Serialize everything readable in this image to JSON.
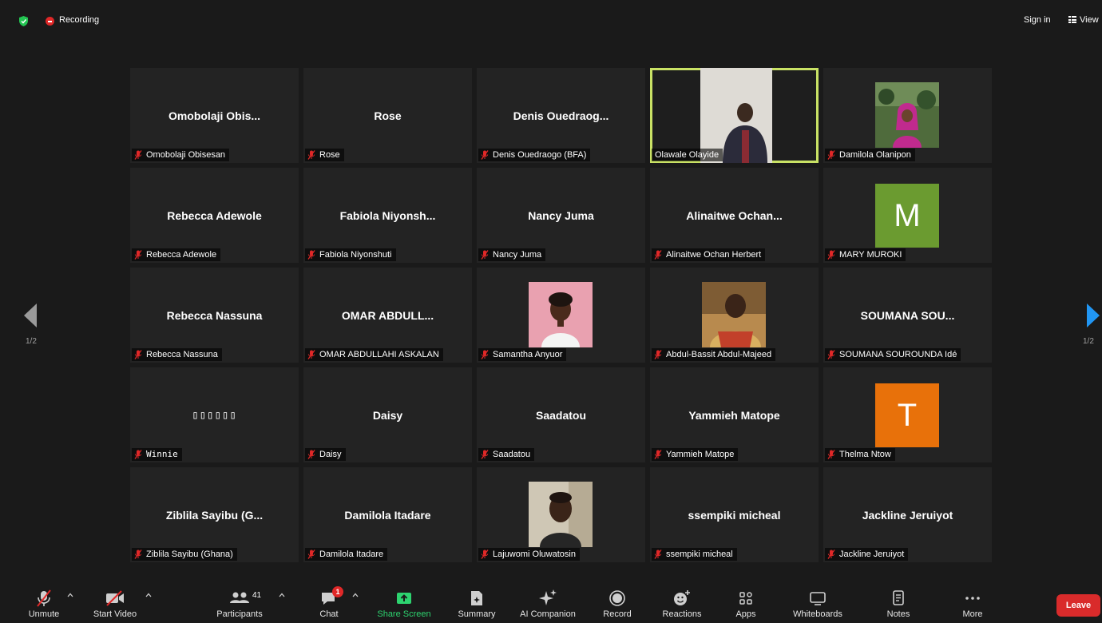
{
  "header": {
    "recording_label": "Recording",
    "sign_in_label": "Sign in",
    "view_label": "View"
  },
  "pager": {
    "left_page": "1/2",
    "right_page": "1/2"
  },
  "tiles": [
    {
      "display_name": "Omobolaji  Obis...",
      "label": "Omobolaji Obisesan",
      "muted": true
    },
    {
      "display_name": "Rose",
      "label": "Rose",
      "muted": true
    },
    {
      "display_name": "Denis  Ouedraog...",
      "label": "Denis Ouedraogo (BFA)",
      "muted": true
    },
    {
      "display_name": "",
      "label": "Olawale Olayide",
      "muted": false,
      "video": "photo",
      "active": true
    },
    {
      "display_name": "",
      "label": "Damilola Olanipon",
      "muted": true,
      "video": "photo"
    },
    {
      "display_name": "Rebecca Adewole",
      "label": "Rebecca Adewole",
      "muted": true
    },
    {
      "display_name": "Fabiola  Niyonsh...",
      "label": "Fabiola Niyonshuti",
      "muted": true
    },
    {
      "display_name": "Nancy Juma",
      "label": "Nancy Juma",
      "muted": true
    },
    {
      "display_name": "Alinaitwe  Ochan...",
      "label": "Alinaitwe Ochan Herbert",
      "muted": true
    },
    {
      "display_name": "",
      "label": "MARY MUROKI",
      "muted": true,
      "avatar_letter": "M",
      "avatar_color": "#6b9b30"
    },
    {
      "display_name": "Rebecca Nassuna",
      "label": "Rebecca Nassuna",
      "muted": true
    },
    {
      "display_name": "OMAR  ABDULL...",
      "label": "OMAR ABDULLAHI ASKALAN",
      "muted": true
    },
    {
      "display_name": "",
      "label": "Samantha Anyuor",
      "muted": true,
      "video": "photo"
    },
    {
      "display_name": "",
      "label": "Abdul-Bassit Abdul-Majeed",
      "muted": true,
      "video": "photo"
    },
    {
      "display_name": "SOUMANA  SOU...",
      "label": "SOUMANA SOUROUNDA Idé",
      "muted": true
    },
    {
      "display_name": "▯▯▯▯▯▯",
      "label": "Winnie",
      "muted": true,
      "mono": true
    },
    {
      "display_name": "Daisy",
      "label": "Daisy",
      "muted": true
    },
    {
      "display_name": "Saadatou",
      "label": "Saadatou",
      "muted": true
    },
    {
      "display_name": "Yammieh Matope",
      "label": "Yammieh Matope",
      "muted": true
    },
    {
      "display_name": "",
      "label": "Thelma Ntow",
      "muted": true,
      "avatar_letter": "T",
      "avatar_color": "#e8710a"
    },
    {
      "display_name": "Ziblila  Sayibu  (G...",
      "label": "Ziblila Sayibu (Ghana)",
      "muted": true
    },
    {
      "display_name": "Damilola Itadare",
      "label": "Damilola Itadare",
      "muted": true
    },
    {
      "display_name": "",
      "label": "Lajuwomi Oluwatosin",
      "muted": true,
      "video": "photo"
    },
    {
      "display_name": "ssempiki micheal",
      "label": "ssempiki micheal",
      "muted": true
    },
    {
      "display_name": "Jackline Jeruiyot",
      "label": "Jackline Jeruiyot",
      "muted": true
    }
  ],
  "toolbar": {
    "unmute": "Unmute",
    "start_video": "Start Video",
    "participants": "Participants",
    "participants_count": "41",
    "chat": "Chat",
    "chat_badge": "1",
    "share_screen": "Share Screen",
    "summary": "Summary",
    "ai_companion": "AI Companion",
    "record": "Record",
    "reactions": "Reactions",
    "apps": "Apps",
    "whiteboards": "Whiteboards",
    "notes": "Notes",
    "more": "More",
    "leave": "Leave"
  },
  "colors": {
    "accent_active_speaker": "#c9e265",
    "share_green": "#2dd36f",
    "leave_red": "#d92b2b",
    "mute_red": "#e02828"
  }
}
